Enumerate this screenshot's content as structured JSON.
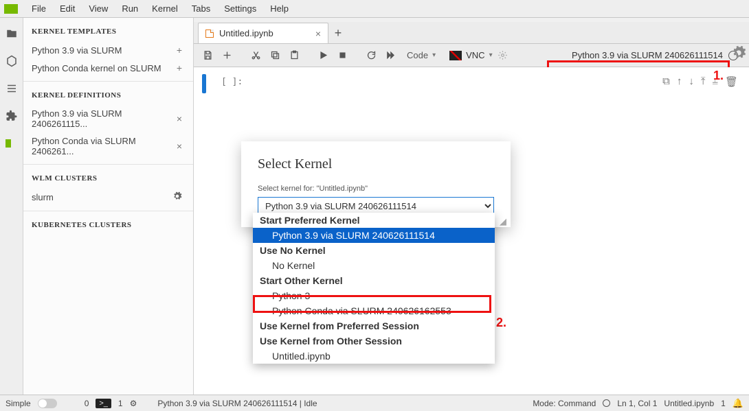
{
  "menu": {
    "items": [
      "File",
      "Edit",
      "View",
      "Run",
      "Kernel",
      "Tabs",
      "Settings",
      "Help"
    ]
  },
  "sidebar": {
    "sections": {
      "templates": {
        "title": "KERNEL TEMPLATES",
        "items": [
          {
            "label": "Python 3.9 via SLURM",
            "action": "+"
          },
          {
            "label": "Python Conda kernel on SLURM",
            "action": "+"
          }
        ]
      },
      "definitions": {
        "title": "KERNEL DEFINITIONS",
        "items": [
          {
            "label": "Python 3.9 via SLURM 2406261115...",
            "action": "×"
          },
          {
            "label": "Python Conda via SLURM 2406261...",
            "action": "×"
          }
        ]
      },
      "wlm": {
        "title": "WLM CLUSTERS",
        "items": [
          {
            "label": "slurm",
            "action": "gear"
          }
        ]
      },
      "kube": {
        "title": "KUBERNETES CLUSTERS",
        "items": []
      }
    }
  },
  "tab": {
    "title": "Untitled.ipynb"
  },
  "toolbar": {
    "cellType": "Code",
    "vnc": "VNC",
    "kernelLabel": "Python 3.9 via SLURM 240626111514"
  },
  "cell": {
    "prompt": "[ ]:"
  },
  "dialog": {
    "title": "Select Kernel",
    "subtitle": "Select kernel for: \"Untitled.ipynb\"",
    "selected": "Python 3.9 via SLURM 240626111514"
  },
  "dropdown": {
    "groups": [
      {
        "label": "Start Preferred Kernel",
        "options": [
          {
            "label": "Python 3.9 via SLURM 240626111514",
            "selected": true
          }
        ]
      },
      {
        "label": "Use No Kernel",
        "options": [
          {
            "label": "No Kernel"
          }
        ]
      },
      {
        "label": "Start Other Kernel",
        "options": [
          {
            "label": "Python 3"
          },
          {
            "label": "Python Conda via SLURM 240626162553"
          }
        ]
      },
      {
        "label": "Use Kernel from Preferred Session",
        "options": []
      },
      {
        "label": "Use Kernel from Other Session",
        "options": [
          {
            "label": "Untitled.ipynb"
          }
        ]
      }
    ]
  },
  "annotations": {
    "one": "1.",
    "two": "2."
  },
  "status": {
    "simple": "Simple",
    "zero": "0",
    "termIcon": ">_",
    "one": "1",
    "kernelStatus": "Python 3.9 via SLURM 240626111514 | Idle",
    "mode": "Mode: Command",
    "ln": "Ln 1, Col 1",
    "doc": "Untitled.ipynb",
    "count": "1"
  }
}
